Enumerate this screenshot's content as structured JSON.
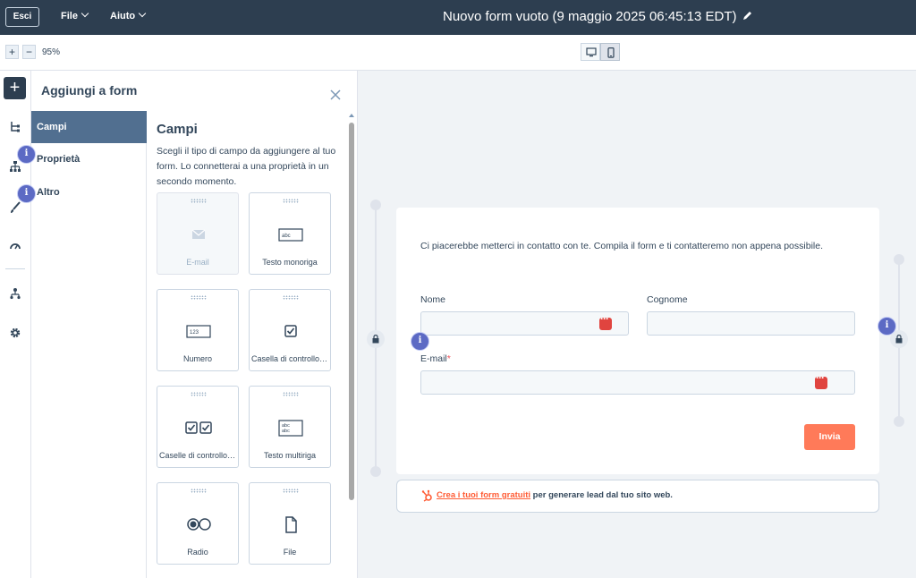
{
  "header": {
    "exit_label": "Esci",
    "menus": [
      {
        "label": "File"
      },
      {
        "label": "Aiuto"
      }
    ],
    "title": "Nuovo form vuoto (9 maggio 2025 06:45:13 EDT)"
  },
  "toolbar": {
    "zoom_in": "+",
    "zoom_out": "−",
    "zoom_level": "95%"
  },
  "left_rail": {
    "add_label": "+",
    "icons": [
      "tree-icon",
      "sitemap-icon",
      "brush-icon",
      "gauge-icon",
      "hierarchy-icon",
      "gear-icon"
    ]
  },
  "panel": {
    "title": "Aggiungi a form",
    "tabs": [
      {
        "label": "Campi"
      },
      {
        "label": "Proprietà"
      },
      {
        "label": "Altro"
      }
    ],
    "content_title": "Campi",
    "content_desc": "Scegli il tipo di campo da aggiungere al tuo form. Lo connetterai a una proprietà in un secondo momento.",
    "cards": [
      {
        "label": "E-mail",
        "icon": "envelope-icon",
        "disabled": true
      },
      {
        "label": "Testo monoriga",
        "icon": "single-line-text-icon"
      },
      {
        "label": "Numero",
        "icon": "number-icon",
        "icon_text": "123"
      },
      {
        "label": "Casella di controllo singola",
        "icon": "checkbox-icon"
      },
      {
        "label": "Caselle di controllo multiple",
        "icon": "checkboxes-icon"
      },
      {
        "label": "Testo multiriga",
        "icon": "multi-line-text-icon",
        "icon_text_1": "abc",
        "icon_text_2": "abc"
      },
      {
        "label": "Radio",
        "icon": "radio-icon"
      },
      {
        "label": "File",
        "icon": "file-icon"
      }
    ],
    "single_line_icon_text": "abc"
  },
  "form": {
    "intro": "Ci piacerebbe metterci in contatto con te. Compila il form e ti contatteremo non appena possibile.",
    "first_name_label": "Nome",
    "last_name_label": "Cognome",
    "email_label": "E-mail",
    "required_mark": "*",
    "submit_label": "Invia"
  },
  "promo": {
    "link_text": "Crea i tuoi form gratuiti",
    "rest_text": " per generare lead dal tuo sito web."
  },
  "info_badge": "i",
  "colors": {
    "topbar": "#2d3e50",
    "accent": "#ff7a59",
    "tab_active": "#516f90",
    "info": "#5c6ac4"
  }
}
